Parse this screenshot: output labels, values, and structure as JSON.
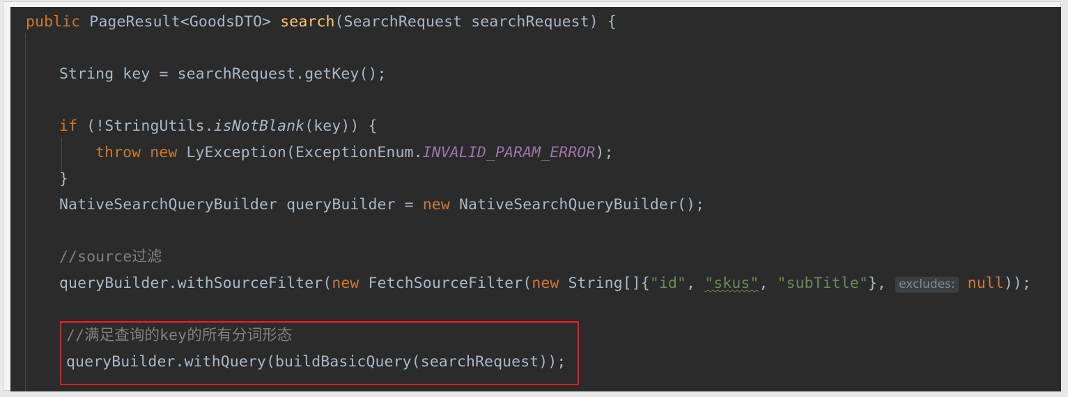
{
  "editor": {
    "language": "java",
    "theme": "darcula",
    "background_color": "#2b2b2b",
    "default_text_color": "#a9b7c6",
    "frame_color": "#f3f3f3"
  },
  "annotation": {
    "shape": "rectangle",
    "color": "#fc1b1b",
    "covers_lines": [
      13,
      14
    ]
  },
  "inlay_hints": [
    {
      "label": "excludes:",
      "color": "#868a91",
      "background": "#3b3f41"
    }
  ],
  "code": {
    "lines": [
      {
        "number": 1,
        "text": "public PageResult<GoodsDTO> search(SearchRequest searchRequest) {",
        "tokens": [
          {
            "t": "public",
            "c": "kw"
          },
          {
            "t": " ",
            "c": "plain"
          },
          {
            "t": "PageResult",
            "c": "plain"
          },
          {
            "t": "<",
            "c": "punct"
          },
          {
            "t": "GoodsDTO",
            "c": "plain"
          },
          {
            "t": "> ",
            "c": "punct"
          },
          {
            "t": "search",
            "c": "method"
          },
          {
            "t": "(",
            "c": "punct"
          },
          {
            "t": "SearchRequest searchRequest",
            "c": "plain"
          },
          {
            "t": ") {",
            "c": "punct"
          }
        ]
      },
      {
        "number": 2,
        "text": ""
      },
      {
        "number": 3,
        "text": "    String key = searchRequest.getKey();",
        "tokens": [
          {
            "t": "    String key = searchRequest.getKey()",
            "c": "plain"
          },
          {
            "t": ";",
            "c": "punct"
          }
        ]
      },
      {
        "number": 4,
        "text": ""
      },
      {
        "number": 5,
        "text": "    if (!StringUtils.isNotBlank(key)) {",
        "tokens": [
          {
            "t": "    ",
            "c": "plain"
          },
          {
            "t": "if",
            "c": "kw"
          },
          {
            "t": " (!StringUtils.",
            "c": "plain"
          },
          {
            "t": "isNotBlank",
            "c": "inst-m"
          },
          {
            "t": "(key)) {",
            "c": "plain"
          }
        ]
      },
      {
        "number": 6,
        "text": "        throw new LyException(ExceptionEnum.INVALID_PARAM_ERROR);",
        "tokens": [
          {
            "t": "        ",
            "c": "plain"
          },
          {
            "t": "throw new",
            "c": "kw"
          },
          {
            "t": " LyException(ExceptionEnum.",
            "c": "plain"
          },
          {
            "t": "INVALID_PARAM_ERROR",
            "c": "static-f"
          },
          {
            "t": ");",
            "c": "plain"
          }
        ]
      },
      {
        "number": 7,
        "text": "    }"
      },
      {
        "number": 8,
        "text": "    NativeSearchQueryBuilder queryBuilder = new NativeSearchQueryBuilder();",
        "tokens": [
          {
            "t": "    NativeSearchQueryBuilder queryBuilder = ",
            "c": "plain"
          },
          {
            "t": "new",
            "c": "kw"
          },
          {
            "t": " NativeSearchQueryBuilder()",
            "c": "plain"
          },
          {
            "t": ";",
            "c": "punct"
          }
        ]
      },
      {
        "number": 9,
        "text": ""
      },
      {
        "number": 10,
        "text": "    //source过滤",
        "tokens": [
          {
            "t": "    ",
            "c": "plain"
          },
          {
            "t": "//source过滤",
            "c": "comment"
          }
        ]
      },
      {
        "number": 11,
        "text": "    queryBuilder.withSourceFilter(new FetchSourceFilter(new String[]{\"id\", \"skus\", \"subTitle\"}, excludes: null));",
        "tokens": [
          {
            "t": "    queryBuilder.withSourceFilter(",
            "c": "plain"
          },
          {
            "t": "new",
            "c": "kw"
          },
          {
            "t": " FetchSourceFilter(",
            "c": "plain"
          },
          {
            "t": "new",
            "c": "kw"
          },
          {
            "t": " String[]{",
            "c": "plain"
          },
          {
            "t": "\"id\"",
            "c": "str"
          },
          {
            "t": ", ",
            "c": "plain"
          },
          {
            "t": "\"skus\"",
            "c": "str-typo"
          },
          {
            "t": ", ",
            "c": "plain"
          },
          {
            "t": "\"subTitle\"",
            "c": "str"
          },
          {
            "t": "}, ",
            "c": "plain"
          },
          {
            "t": "excludes:",
            "c": "inlay"
          },
          {
            "t": " null",
            "c": "kw"
          },
          {
            "t": "));",
            "c": "plain"
          }
        ]
      },
      {
        "number": 12,
        "text": ""
      },
      {
        "number": 13,
        "text": "    //满足查询的key的所有分词形态",
        "tokens": [
          {
            "t": "    ",
            "c": "plain"
          },
          {
            "t": "//满足查询的key的所有分词形态",
            "c": "comment"
          }
        ]
      },
      {
        "number": 14,
        "text": "    queryBuilder.withQuery(buildBasicQuery(searchRequest));",
        "tokens": [
          {
            "t": "    queryBuilder.withQuery(buildBasicQuery(searchRequest))",
            "c": "plain"
          },
          {
            "t": ";",
            "c": "punct"
          }
        ]
      }
    ]
  },
  "line_text": {
    "l1_public": "public",
    "l1_type": " PageResult",
    "l1_lt": "<",
    "l1_generic": "GoodsDTO",
    "l1_gt": "> ",
    "l1_method": "search",
    "l1_open": "(",
    "l1_params": "SearchRequest searchRequest",
    "l1_close": ") {",
    "l3": "String key = searchRequest.getKey()",
    "l3_semi": ";",
    "l5_if": "if",
    "l5_rest": " (!StringUtils.",
    "l5_m": "isNotBlank",
    "l5_tail": "(key)) {",
    "l6_kw": "throw new",
    "l6_mid": " LyException(ExceptionEnum.",
    "l6_const": "INVALID_PARAM_ERROR",
    "l6_tail": ");",
    "l7": "}",
    "l8_head": "NativeSearchQueryBuilder queryBuilder = ",
    "l8_new": "new",
    "l8_tail": " NativeSearchQueryBuilder()",
    "l8_semi": ";",
    "l10_comment": "//source过滤",
    "l11_a": "queryBuilder.withSourceFilter(",
    "l11_new1": "new",
    "l11_b": " FetchSourceFilter(",
    "l11_new2": "new",
    "l11_c": " String[]{",
    "l11_s1": "\"id\"",
    "l11_sep1": ", ",
    "l11_s2": "\"skus\"",
    "l11_sep2": ", ",
    "l11_s3": "\"subTitle\"",
    "l11_d": "}, ",
    "l11_inlay": "excludes:",
    "l11_null": "null",
    "l11_tail": "));",
    "l13_comment": "//满足查询的key的所有分词形态",
    "l14": "queryBuilder.withQuery(buildBasicQuery(searchRequest))",
    "l14_semi": ";"
  }
}
